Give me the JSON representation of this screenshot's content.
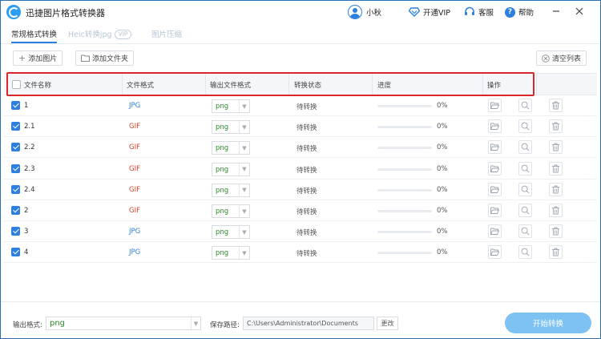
{
  "app": {
    "title": "迅捷图片格式转换器"
  },
  "titlebar": {
    "username": "小秋",
    "vip_label": "开通VIP",
    "service_label": "客服",
    "help_label": "帮助"
  },
  "tabs": [
    {
      "label": "常规格式转换"
    },
    {
      "label": "Heic转换jpg",
      "badge": "VIP"
    },
    {
      "label": "图片压缩"
    }
  ],
  "toolbar": {
    "add_image": "添加图片",
    "add_folder": "添加文件夹",
    "clear_list": "清空列表"
  },
  "table": {
    "headers": [
      "文件名称",
      "文件格式",
      "输出文件格式",
      "转换状态",
      "进度",
      "操作"
    ],
    "rows": [
      {
        "name": "1",
        "format": "JPG",
        "output": "png",
        "status": "待转换",
        "progress": "0%",
        "progress_value": 0
      },
      {
        "name": "2.1",
        "format": "GIF",
        "output": "png",
        "status": "待转换",
        "progress": "0%",
        "progress_value": 0
      },
      {
        "name": "2.2",
        "format": "GIF",
        "output": "png",
        "status": "待转换",
        "progress": "0%",
        "progress_value": 0
      },
      {
        "name": "2.3",
        "format": "GIF",
        "output": "png",
        "status": "待转换",
        "progress": "0%",
        "progress_value": 0
      },
      {
        "name": "2.4",
        "format": "GIF",
        "output": "png",
        "status": "待转换",
        "progress": "0%",
        "progress_value": 0
      },
      {
        "name": "2",
        "format": "GIF",
        "output": "png",
        "status": "待转换",
        "progress": "0%",
        "progress_value": 0
      },
      {
        "name": "3",
        "format": "JPG",
        "output": "png",
        "status": "待转换",
        "progress": "0%",
        "progress_value": 0
      },
      {
        "name": "4",
        "format": "JPG",
        "output": "png",
        "status": "待转换",
        "progress": "0%",
        "progress_value": 0
      }
    ]
  },
  "bottom": {
    "output_format_label": "输出格式:",
    "output_format_value": "png",
    "save_path_label": "保存路径:",
    "save_path_value": "C:\\Users\\Administrator\\Documents",
    "change_label": "更改",
    "start_label": "开始转换"
  },
  "colors": {
    "accent": "#2d7fe0",
    "jpg": "#2d7fe0",
    "gif": "#d9432c",
    "png": "#2b8a2b",
    "highlight": "#d9262c",
    "start_button": "#7ec2f4"
  }
}
